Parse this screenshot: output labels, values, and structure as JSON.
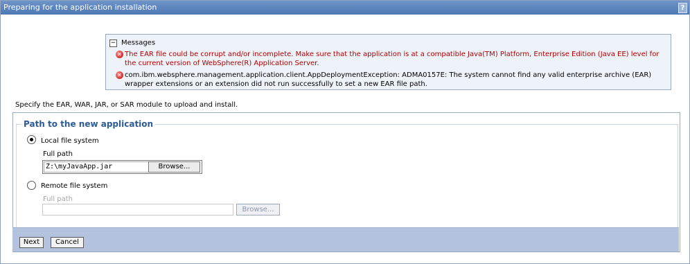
{
  "title_bar": {
    "title": "Preparing for the application installation",
    "help_label": "?"
  },
  "messages": {
    "header": "Messages",
    "collapse_symbol": "−",
    "items": [
      {
        "type": "error",
        "text": "The EAR file could be corrupt and/or incomplete. Make sure that the application is at a compatible Java(TM) Platform, Enterprise Edition (Java EE) level for the current version of WebSphere(R) Application Server."
      },
      {
        "type": "error",
        "text": "com.ibm.websphere.management.application.client.AppDeploymentException: ADMA0157E: The system cannot find any valid enterprise archive (EAR) wrapper extensions or an extension did not run successfully to set a new EAR file path."
      }
    ],
    "colors": {
      "error_text": "#b00000",
      "panel_bg": "#eef3fa"
    }
  },
  "instruction": "Specify the EAR, WAR, JAR, or SAR module to upload and install.",
  "path_section": {
    "legend": "Path to the new application",
    "local": {
      "label": "Local file system",
      "checked": true,
      "full_path_label": "Full path",
      "value": "Z:\\myJavaApp.jar",
      "browse_label": "Browse..."
    },
    "remote": {
      "label": "Remote file system",
      "checked": false,
      "full_path_label": "Full path",
      "value": "",
      "browse_label": "Browse..."
    }
  },
  "footer": {
    "next_label": "Next",
    "cancel_label": "Cancel"
  },
  "theme": {
    "title_bar": "#5a82bd",
    "legend": "#2c5b96",
    "footer_bg": "#b3c3dd"
  }
}
